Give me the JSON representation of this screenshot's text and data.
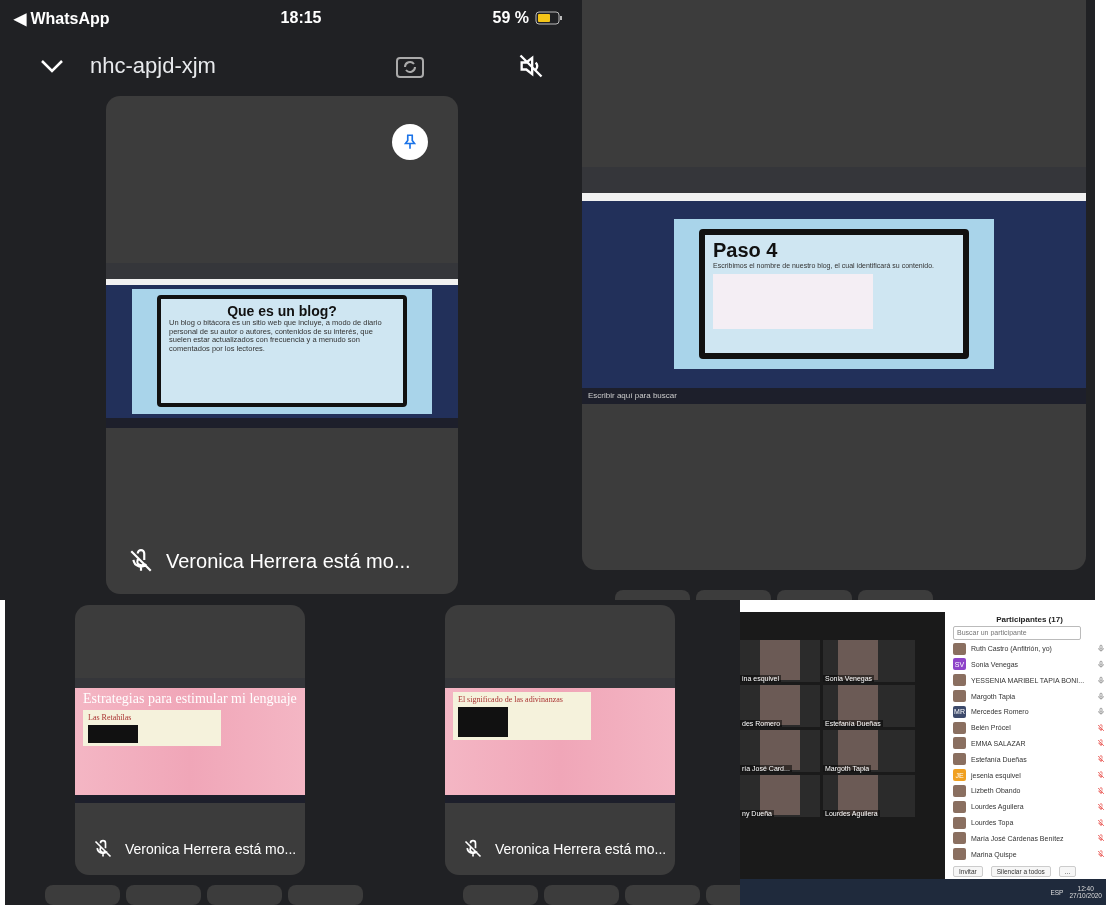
{
  "status_bar": {
    "back_app": "◀ WhatsApp",
    "time": "18:15",
    "battery": "59 %"
  },
  "meeting": {
    "code": "nhc-apjd-xjm"
  },
  "main_tile": {
    "pinned": true,
    "caption": "Veronica Herrera está mo...",
    "slide": {
      "title": "Que es un blog?",
      "body": "Un blog o bitácora es un sitio web que incluye, a modo de diario personal de su autor o autores, contenidos de su interés, que suelen estar actualizados con frecuencia y a menudo son comentados por los lectores."
    }
  },
  "second_tile": {
    "slide": {
      "title": "Paso 4",
      "subtitle": "Escribimos el nombre de nuestro blog, el cual identificará su contenido."
    },
    "taskbar_search": "Escribir aquí para buscar"
  },
  "small_tiles": [
    {
      "caption": "Veronica Herrera está mo...",
      "blog_title": "Estrategias para estimular mi lenguaje",
      "post_title": "Las Retahílas"
    },
    {
      "caption": "Veronica Herrera está mo...",
      "post_title": "El significado de las adivinanzas"
    }
  ],
  "zoom": {
    "video_names": [
      "ina esquivel",
      "Sonia Venegas",
      "des Romero",
      "Estefanía Dueñas",
      "ría José Card...",
      "Margoth Tapia",
      "ny Dueña",
      "Lourdes Aguilera"
    ],
    "participants_title": "Participantes (17)",
    "search_placeholder": "Buscar un participante",
    "participants": [
      {
        "name": "Ruth Castro (Anfitrión, yo)",
        "muted": false,
        "kind": "photo"
      },
      {
        "name": "Sonia Venegas",
        "muted": false,
        "kind": "initials",
        "initials": "SV",
        "color": "#8e44c9"
      },
      {
        "name": "YESSENIA MARIBEL TAPIA BONI...",
        "muted": false,
        "kind": "photo"
      },
      {
        "name": "Margoth Tapia",
        "muted": false,
        "kind": "photo"
      },
      {
        "name": "Mercedes Romero",
        "muted": false,
        "kind": "initials",
        "initials": "MR",
        "color": "#3d4a6b"
      },
      {
        "name": "Belén Prócel",
        "muted": true,
        "kind": "photo"
      },
      {
        "name": "EMMA SALAZAR",
        "muted": true,
        "kind": "photo"
      },
      {
        "name": "Estefanía Dueñas",
        "muted": true,
        "kind": "photo"
      },
      {
        "name": "jesenia esquivel",
        "muted": true,
        "kind": "initials",
        "initials": "JE",
        "color": "#f0a020"
      },
      {
        "name": "Lizbeth Obando",
        "muted": true,
        "kind": "photo"
      },
      {
        "name": "Lourdes Aguilera",
        "muted": true,
        "kind": "photo"
      },
      {
        "name": "Lourdes Topa",
        "muted": true,
        "kind": "photo"
      },
      {
        "name": "María José Cárdenas Benítez",
        "muted": true,
        "kind": "photo"
      },
      {
        "name": "Marina Quispe",
        "muted": true,
        "kind": "photo"
      }
    ],
    "buttons": [
      "Invitar",
      "Silenciar a todos",
      "..."
    ],
    "taskbar": {
      "language": "ESP",
      "time": "12:40",
      "date": "27/10/2020"
    }
  }
}
